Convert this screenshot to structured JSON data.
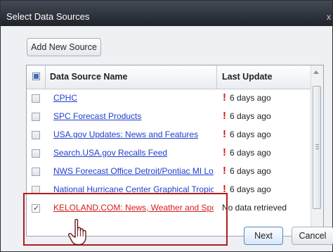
{
  "window": {
    "title": "Select Data Sources",
    "close_label": "x"
  },
  "toolbar": {
    "add_source_label": "Add New Source"
  },
  "table": {
    "headers": {
      "name": "Data Source Name",
      "update": "Last Update"
    },
    "header_checkbox_state": "indeterminate",
    "rows": [
      {
        "name": "CPHC",
        "update": "6 days ago",
        "warning": true,
        "checked": false
      },
      {
        "name": "SPC Forecast Products",
        "update": "6 days ago",
        "warning": true,
        "checked": false
      },
      {
        "name": "USA.gov Updates: News and Features",
        "update": "6 days ago",
        "warning": true,
        "checked": false
      },
      {
        "name": "Search.USA.gov Recalls Feed",
        "update": "6 days ago",
        "warning": true,
        "checked": false
      },
      {
        "name": "NWS Forecast Office Detroit/Pontiac MI Local",
        "update": "6 days ago",
        "warning": true,
        "checked": false
      },
      {
        "name": "National Hurricane Center Graphical Tropical W",
        "update": "6 days ago",
        "warning": true,
        "checked": false
      },
      {
        "name": "KELOLAND.COM: News, Weather and Sports",
        "update": "No data retrieved",
        "warning": false,
        "checked": true
      }
    ]
  },
  "buttons": {
    "next_label": "Next",
    "cancel_label": "Cancel"
  },
  "icons": {
    "warning": "!",
    "pointer": "hand-pointer-icon"
  },
  "colors": {
    "link": "#1f3fcf",
    "selected_link": "#d41e1e",
    "warning": "#d81a1a",
    "highlight_box": "#b31d1d",
    "title_bar": "#2a2f37"
  }
}
